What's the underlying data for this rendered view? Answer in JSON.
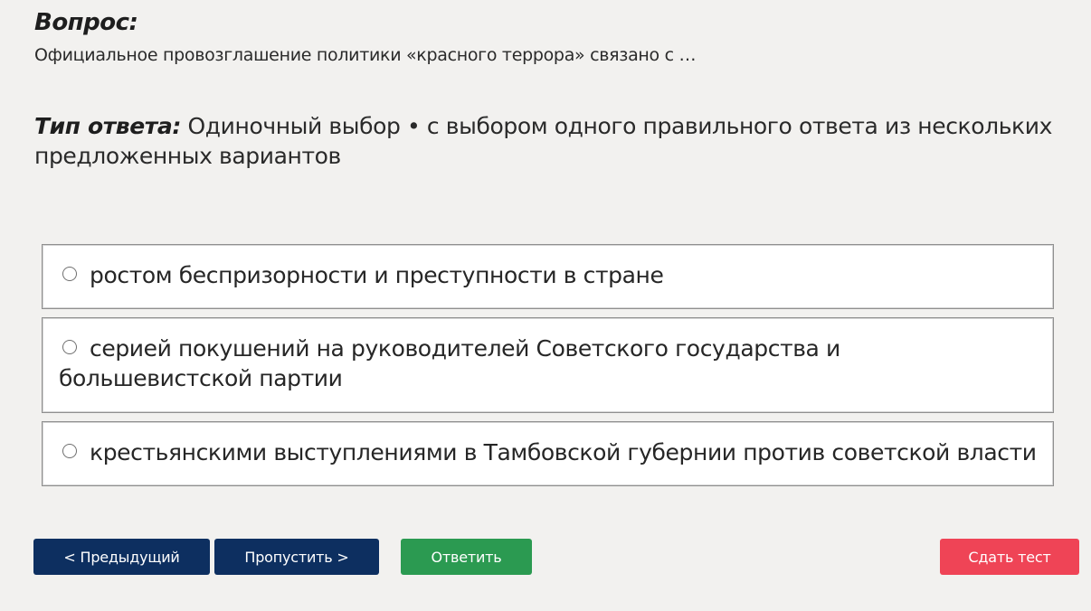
{
  "question": {
    "heading": "Вопрос:",
    "text": "Официальное провозглашение политики «красного террора» связано с …"
  },
  "answer_type": {
    "label": "Тип ответа:",
    "value": "Одиночный выбор • с выбором одного правильного ответа из нескольких предложенных вариантов"
  },
  "options": [
    {
      "label": "ростом беспризорности и преступности в стране",
      "selected": false
    },
    {
      "label": "серией покушений на руководителей Советского государства и большевистской партии",
      "selected": false
    },
    {
      "label": "крестьянскими выступлениями в Тамбовской губернии против советской власти",
      "selected": false
    }
  ],
  "buttons": {
    "prev": "< Предыдущий",
    "skip": "Пропустить >",
    "answer": "Ответить",
    "submit": "Сдать тест"
  },
  "colors": {
    "background": "#f2f1ef",
    "nav_button": "#0d2f60",
    "answer_button": "#2b9a51",
    "submit_button": "#ef4456"
  }
}
